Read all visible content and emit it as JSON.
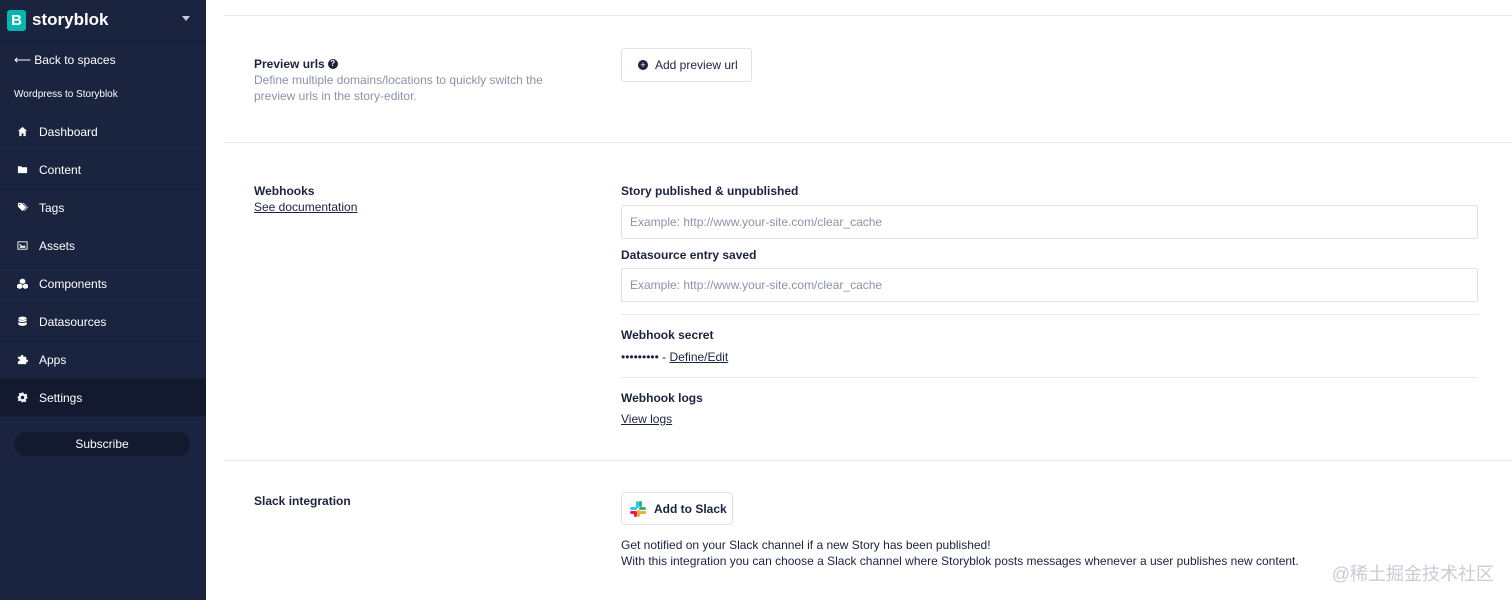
{
  "brand": {
    "name": "storyblok",
    "logo_letter": "B"
  },
  "sidebar": {
    "back_label": "Back to spaces",
    "back_arrow": "⟵",
    "space_name": "Wordpress to Storyblok",
    "items": [
      {
        "label": "Dashboard",
        "icon": "home-icon",
        "active": false
      },
      {
        "label": "Content",
        "icon": "folder-icon",
        "active": false
      },
      {
        "label": "Tags",
        "icon": "tags-icon",
        "active": false
      },
      {
        "label": "Assets",
        "icon": "image-icon",
        "active": false
      },
      {
        "label": "Components",
        "icon": "cubes-icon",
        "active": false
      },
      {
        "label": "Datasources",
        "icon": "database-icon",
        "active": false
      },
      {
        "label": "Apps",
        "icon": "puzzle-icon",
        "active": false
      },
      {
        "label": "Settings",
        "icon": "gear-icon",
        "active": true
      }
    ],
    "subscribe_label": "Subscribe"
  },
  "preview": {
    "title": "Preview urls",
    "help_glyph": "?",
    "description": "Define multiple domains/locations to quickly switch the preview urls in the story-editor.",
    "add_button_label": "Add preview url",
    "add_button_glyph": "+"
  },
  "webhooks": {
    "title": "Webhooks",
    "doc_link": "See documentation",
    "story_label": "Story published & unpublished",
    "story_placeholder": "Example: http://www.your-site.com/clear_cache",
    "datasource_label": "Datasource entry saved",
    "datasource_placeholder": "Example: http://www.your-site.com/clear_cache",
    "secret_label": "Webhook secret",
    "secret_masked": "••••••••• - ",
    "secret_link": "Define/Edit",
    "logs_label": "Webhook logs",
    "logs_link": "View logs"
  },
  "slack": {
    "title": "Slack integration",
    "button_label": "Add to Slack",
    "desc_line1": "Get notified on your Slack channel if a new Story has been published!",
    "desc_line2": "With this integration you can choose a Slack channel where Storyblok posts messages whenever a user publishes new content."
  },
  "watermark": "@稀土掘金技术社区",
  "colors": {
    "sidebar_bg": "#1b243f",
    "brand_accent": "#09b3af",
    "text_primary": "#1b243f",
    "text_muted": "#8b93a7",
    "border": "#dfe3e8"
  }
}
